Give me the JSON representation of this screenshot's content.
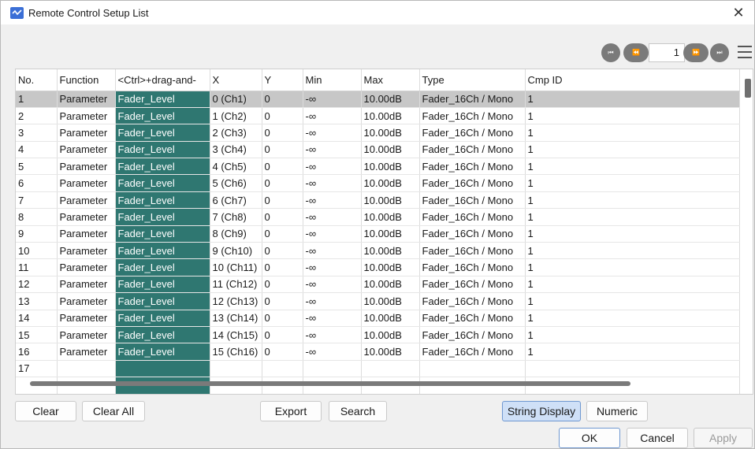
{
  "window": {
    "title": "Remote Control Setup List",
    "close_glyph": "✕"
  },
  "pager": {
    "first": "⏮",
    "prev": "⏪",
    "page": "1",
    "next": "⏩",
    "last": "⏭"
  },
  "table": {
    "headers": [
      "No.",
      "Function",
      "<Ctrl>+drag-and-",
      "X",
      "Y",
      "Min",
      "Max",
      "Type",
      "Cmp ID"
    ],
    "rows": [
      [
        "1",
        "Parameter",
        "Fader_Level",
        "0 (Ch1)",
        "0",
        "-∞",
        "10.00dB",
        "Fader_16Ch / Mono",
        "1"
      ],
      [
        "2",
        "Parameter",
        "Fader_Level",
        "1 (Ch2)",
        "0",
        "-∞",
        "10.00dB",
        "Fader_16Ch / Mono",
        "1"
      ],
      [
        "3",
        "Parameter",
        "Fader_Level",
        "2 (Ch3)",
        "0",
        "-∞",
        "10.00dB",
        "Fader_16Ch / Mono",
        "1"
      ],
      [
        "4",
        "Parameter",
        "Fader_Level",
        "3 (Ch4)",
        "0",
        "-∞",
        "10.00dB",
        "Fader_16Ch / Mono",
        "1"
      ],
      [
        "5",
        "Parameter",
        "Fader_Level",
        "4 (Ch5)",
        "0",
        "-∞",
        "10.00dB",
        "Fader_16Ch / Mono",
        "1"
      ],
      [
        "6",
        "Parameter",
        "Fader_Level",
        "5 (Ch6)",
        "0",
        "-∞",
        "10.00dB",
        "Fader_16Ch / Mono",
        "1"
      ],
      [
        "7",
        "Parameter",
        "Fader_Level",
        "6 (Ch7)",
        "0",
        "-∞",
        "10.00dB",
        "Fader_16Ch / Mono",
        "1"
      ],
      [
        "8",
        "Parameter",
        "Fader_Level",
        "7 (Ch8)",
        "0",
        "-∞",
        "10.00dB",
        "Fader_16Ch / Mono",
        "1"
      ],
      [
        "9",
        "Parameter",
        "Fader_Level",
        "8 (Ch9)",
        "0",
        "-∞",
        "10.00dB",
        "Fader_16Ch / Mono",
        "1"
      ],
      [
        "10",
        "Parameter",
        "Fader_Level",
        "9 (Ch10)",
        "0",
        "-∞",
        "10.00dB",
        "Fader_16Ch / Mono",
        "1"
      ],
      [
        "11",
        "Parameter",
        "Fader_Level",
        "10 (Ch11)",
        "0",
        "-∞",
        "10.00dB",
        "Fader_16Ch / Mono",
        "1"
      ],
      [
        "12",
        "Parameter",
        "Fader_Level",
        "11 (Ch12)",
        "0",
        "-∞",
        "10.00dB",
        "Fader_16Ch / Mono",
        "1"
      ],
      [
        "13",
        "Parameter",
        "Fader_Level",
        "12 (Ch13)",
        "0",
        "-∞",
        "10.00dB",
        "Fader_16Ch / Mono",
        "1"
      ],
      [
        "14",
        "Parameter",
        "Fader_Level",
        "13 (Ch14)",
        "0",
        "-∞",
        "10.00dB",
        "Fader_16Ch / Mono",
        "1"
      ],
      [
        "15",
        "Parameter",
        "Fader_Level",
        "14 (Ch15)",
        "0",
        "-∞",
        "10.00dB",
        "Fader_16Ch / Mono",
        "1"
      ],
      [
        "16",
        "Parameter",
        "Fader_Level",
        "15 (Ch16)",
        "0",
        "-∞",
        "10.00dB",
        "Fader_16Ch / Mono",
        "1"
      ],
      [
        "17",
        "",
        "",
        "",
        "",
        "",
        "",
        "",
        ""
      ],
      [
        "",
        "",
        "",
        "",
        "",
        "",
        "",
        "",
        ""
      ]
    ],
    "selected_row": 0
  },
  "buttons": {
    "clear": "Clear",
    "clear_all": "Clear All",
    "export": "Export",
    "search": "Search",
    "string_display": "String Display",
    "numeric": "Numeric",
    "ok": "OK",
    "cancel": "Cancel",
    "apply": "Apply"
  },
  "colors": {
    "accent_teal": "#2f7771",
    "selection_gray": "#c7c7c7",
    "toggle_active": "#cfe0f7"
  }
}
